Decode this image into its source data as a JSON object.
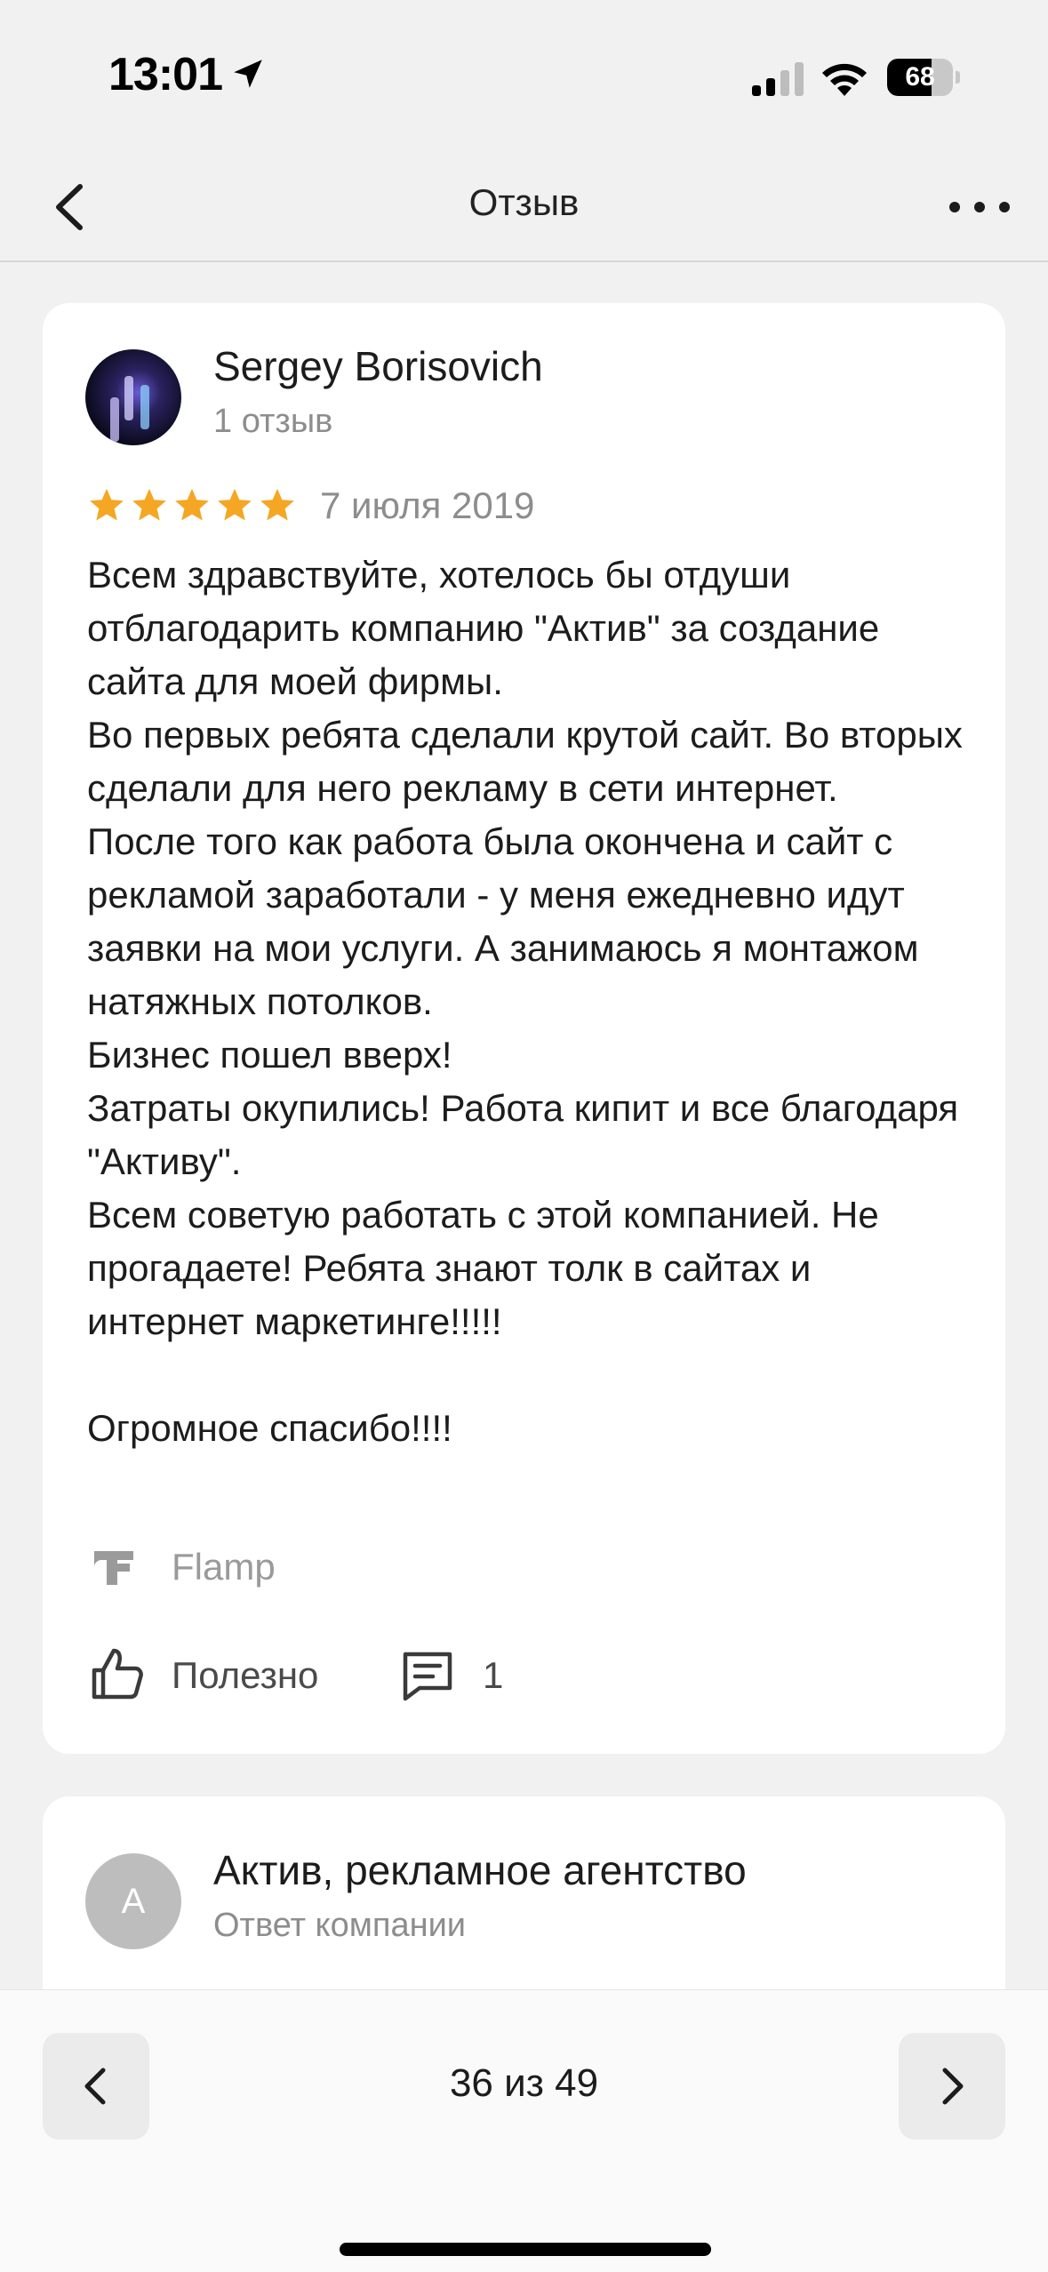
{
  "status_bar": {
    "time": "13:01",
    "battery_level": 68,
    "battery_text": "68",
    "icons": [
      "location-arrow-icon",
      "signal-icon",
      "wifi-icon",
      "battery-icon"
    ]
  },
  "nav": {
    "title": "Отзыв",
    "back_icon": "chevron-left-icon",
    "more_icon": "more-dots-icon"
  },
  "review": {
    "author_name": "Sergey Borisovich",
    "author_reviews": "1 отзыв",
    "rating": 5,
    "rating_max": 5,
    "star_color": "#f5a623",
    "date": "7 июля 2019",
    "text": "Всем здравствуйте, хотелось бы отдуши отблагодарить компанию \"Актив\" за создание сайта для моей фирмы.\nВо первых ребята сделали крутой сайт. Во вторых сделали для него рекламу в сети интернет.\nПосле того как работа была окончена и сайт с рекламой заработали - у меня ежедневно идут заявки на мои услуги. А занимаюсь я монтажом натяжных потолков.\nБизнес пошел вверх!\nЗатраты окупились! Работа кипит и все благодаря \"Активу\".\nВсем советую работать с этой компанией. Не прогадаете! Ребята знают толк в сайтах и интернет маркетинге!!!!!\n\nОгромное спасибо!!!!",
    "source": "Flamp",
    "like_label": "Полезно",
    "comment_count": "1"
  },
  "reply": {
    "avatar_letter": "А",
    "company_name": "Актив, рекламное агентство",
    "subtitle": "Ответ компании"
  },
  "pager": {
    "label": "36 из 49"
  }
}
